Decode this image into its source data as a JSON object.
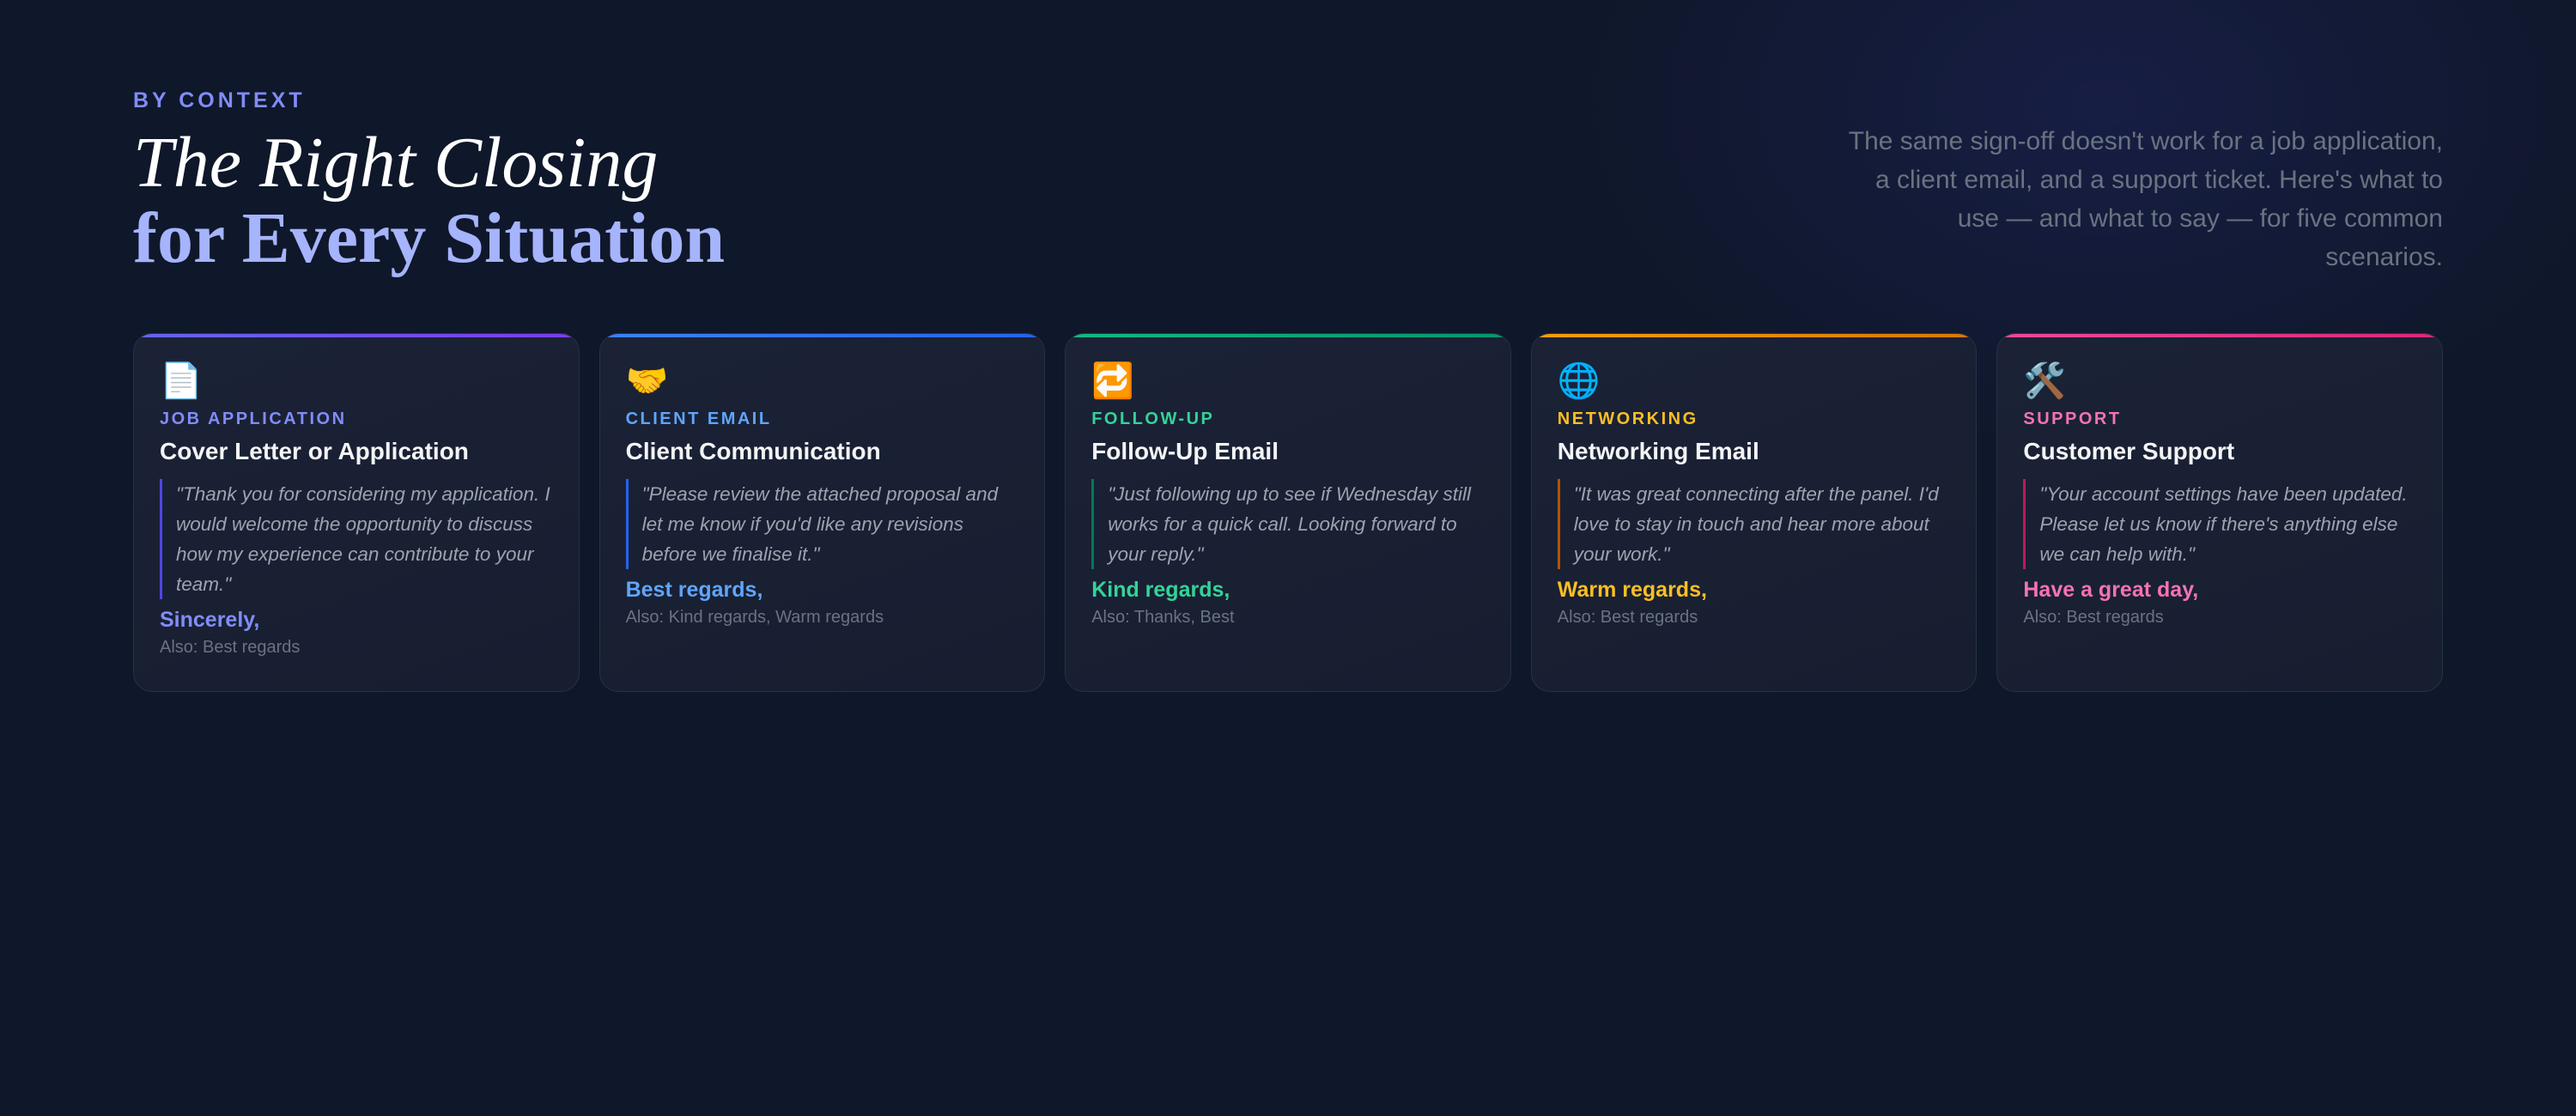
{
  "header": {
    "eyebrow": "BY CONTEXT",
    "title_line1": "The Right Closing",
    "title_line2": "for Every Situation",
    "intro": "The same sign-off doesn't work for a job application, a client email, and a support ticket. Here's what to use — and what to say — for five common scenarios."
  },
  "cards": [
    {
      "icon": "document-icon",
      "icon_glyph": "📄",
      "tag": "JOB APPLICATION",
      "title": "Cover Letter or Application",
      "quote": "\"Thank you for considering my application. I would welcome the opportunity to discuss how my experience can contribute to your team.\"",
      "closing": "Sincerely,",
      "also": "Also: Best regards",
      "accent": "#818cf8",
      "bar_start": "#6366f1",
      "bar_end": "#7c3aed",
      "quote_border": "#4f46e5"
    },
    {
      "icon": "handshake-icon",
      "icon_glyph": "🤝",
      "tag": "CLIENT EMAIL",
      "title": "Client Communication",
      "quote": "\"Please review the attached proposal and let me know if you'd like any revisions before we finalise it.\"",
      "closing": "Best regards,",
      "also": "Also: Kind regards, Warm regards",
      "accent": "#60a5fa",
      "bar_start": "#3b82f6",
      "bar_end": "#2563eb",
      "quote_border": "#2563eb"
    },
    {
      "icon": "repeat-icon",
      "icon_glyph": "🔁",
      "tag": "FOLLOW-UP",
      "title": "Follow-Up Email",
      "quote": "\"Just following up to see if Wednesday still works for a quick call. Looking forward to your reply.\"",
      "closing": "Kind regards,",
      "also": "Also: Thanks, Best",
      "accent": "#34d399",
      "bar_start": "#10b981",
      "bar_end": "#059669",
      "quote_border": "#047857"
    },
    {
      "icon": "globe-icon",
      "icon_glyph": "🌐",
      "tag": "NETWORKING",
      "title": "Networking Email",
      "quote": "\"It was great connecting after the panel. I'd love to stay in touch and hear more about your work.\"",
      "closing": "Warm regards,",
      "also": "Also: Best regards",
      "accent": "#fbbf24",
      "bar_start": "#f59e0b",
      "bar_end": "#d97706",
      "quote_border": "#b45309"
    },
    {
      "icon": "tools-icon",
      "icon_glyph": "🛠️",
      "tag": "SUPPORT",
      "title": "Customer Support",
      "quote": "\"Your account settings have been updated. Please let us know if there's anything else we can help with.\"",
      "closing": "Have a great day,",
      "also": "Also: Best regards",
      "accent": "#f472b6",
      "bar_start": "#ec4899",
      "bar_end": "#db2777",
      "quote_border": "#be185d"
    }
  ]
}
